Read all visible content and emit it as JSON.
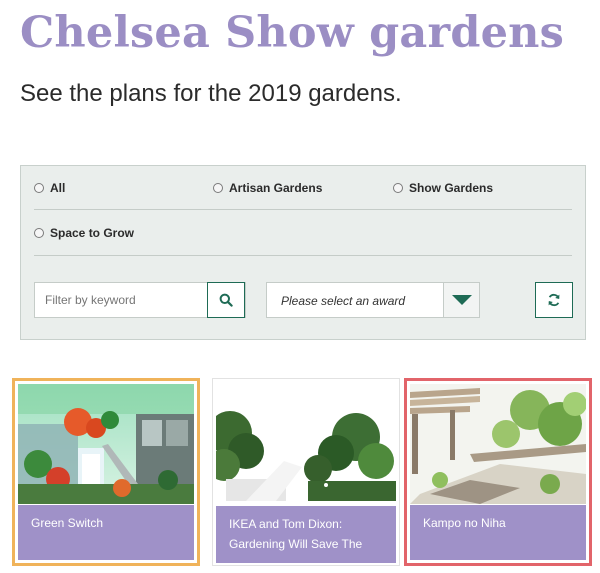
{
  "header": {
    "title": "Chelsea Show gardens",
    "subtitle": "See the plans for the 2019 gardens."
  },
  "filters": {
    "radios": [
      {
        "label": "All"
      },
      {
        "label": "Artisan Gardens"
      },
      {
        "label": "Show Gardens"
      },
      {
        "label": "Space to Grow"
      }
    ],
    "search": {
      "placeholder": "Filter by keyword",
      "value": ""
    },
    "award_select": {
      "placeholder": "Please select an award"
    }
  },
  "cards": [
    {
      "title": "Green Switch",
      "border_color": "#f0b35a"
    },
    {
      "title": "IKEA and Tom Dixon: Gardening Will Save The",
      "border_color": "#e2e2e2"
    },
    {
      "title": "Kampo no Niha",
      "border_color": "#e2646a"
    }
  ],
  "colors": {
    "title": "#9b8ec4",
    "panel_bg": "#eaeeec",
    "accent_green": "#1e6b55",
    "card_label_bg": "#9f91c8"
  }
}
